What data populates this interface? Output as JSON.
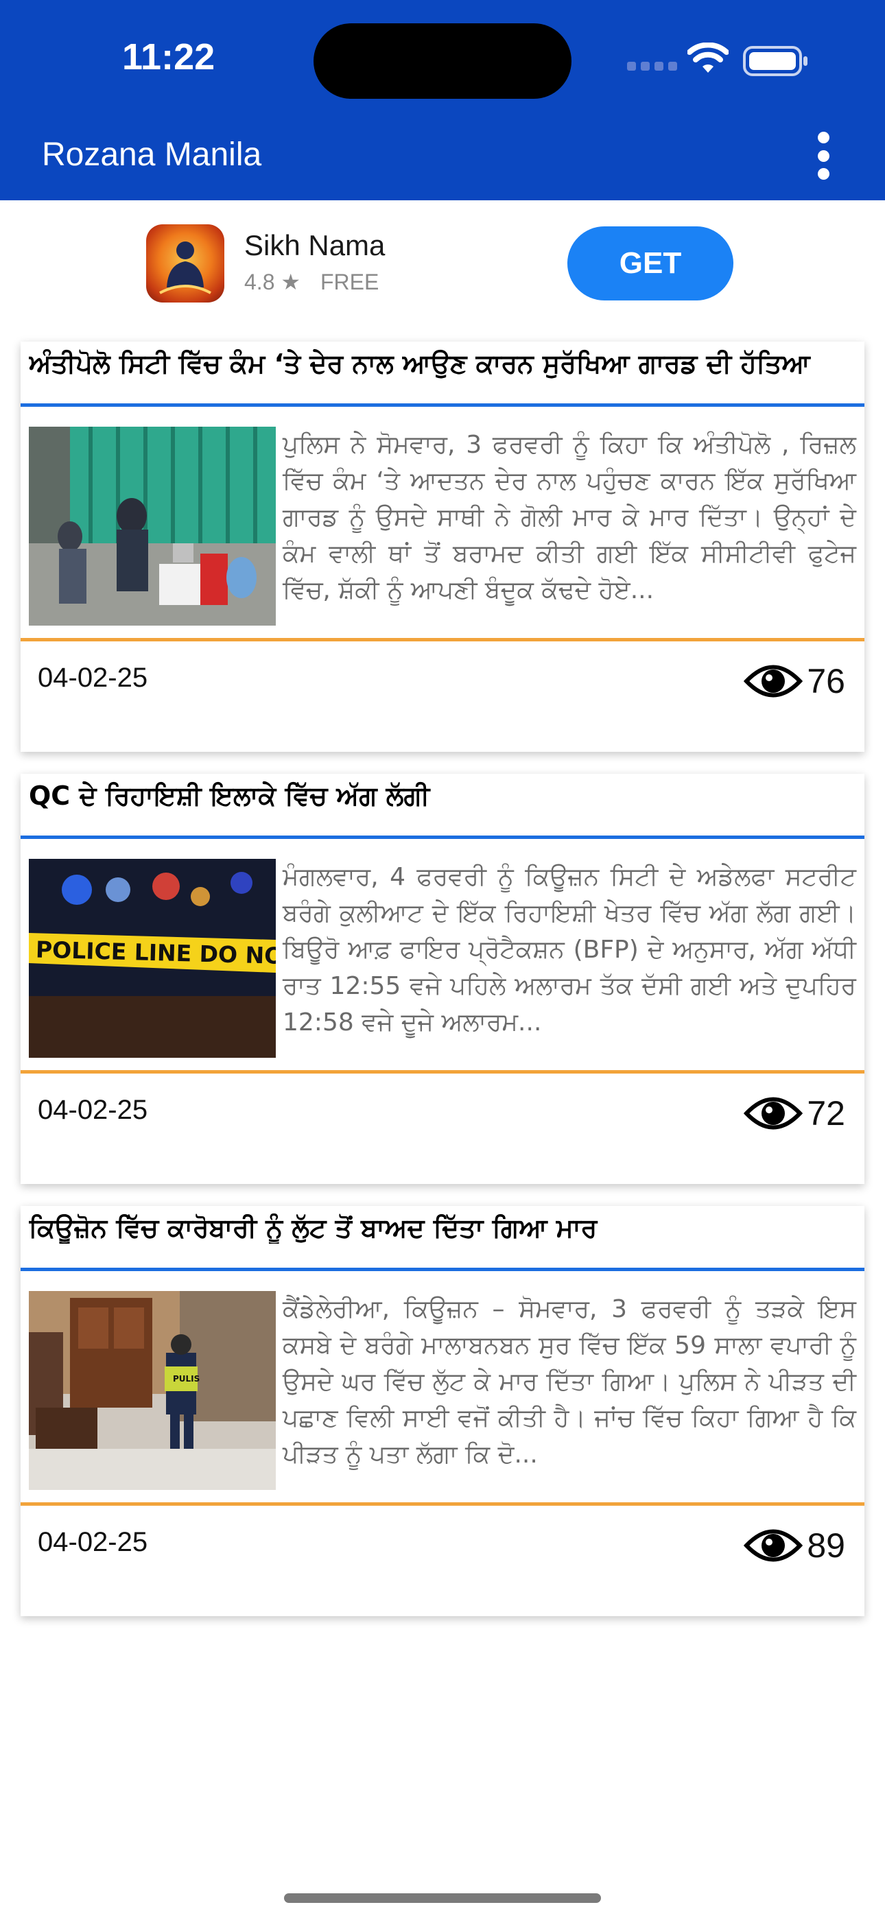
{
  "status_bar": {
    "time": "11:22"
  },
  "header": {
    "title": "Rozana Manila",
    "menu_icon": "more-vertical-icon"
  },
  "ad": {
    "app_name": "Sikh Nama",
    "rating": "4.8",
    "rating_icon": "star-icon",
    "price": "FREE",
    "cta": "GET"
  },
  "articles": [
    {
      "title": "ਅੰਤੀਪੋਲੋ ਸਿਟੀ ਵਿੱਚ ਕੰਮ ‘ਤੇ ਦੇਰ ਨਾਲ ਆਉਣ ਕਾਰਨ ਸੁਰੱਖਿਆ ਗਾਰਡ ਦੀ ਹੱਤਿਆ",
      "excerpt": "ਪੁਲਿਸ ਨੇ ਸੋਮਵਾਰ, 3 ਫਰਵਰੀ ਨੂੰ ਕਿਹਾ ਕਿ ਅੰਤੀਪੋਲੋ , ਰਿਜ਼ਲ ਵਿੱਚ ਕੰਮ ‘ਤੇ ਆਦਤਨ ਦੇਰ ਨਾਲ ਪਹੁੰਚਣ ਕਾਰਨ ਇੱਕ ਸੁਰੱਖਿਆ ਗਾਰਡ ਨੂੰ ਉਸਦੇ ਸਾਥੀ ਨੇ ਗੋਲੀ ਮਾਰ ਕੇ ਮਾਰ ਦਿੱਤਾ। ਉਨ੍ਹਾਂ ਦੇ ਕੰਮ ਵਾਲੀ ਥਾਂ ਤੋਂ ਬਰਾਮਦ ਕੀਤੀ ਗਈ ਇੱਕ ਸੀਸੀਟੀਵੀ ਫੁਟੇਜ ਵਿੱਚ, ਸ਼ੱਕੀ ਨੂੰ ਆਪਣੀ ਬੰਦੂਕ ਕੱਢਦੇ ਹੋਏ...",
      "date": "04-02-25",
      "views": "76"
    },
    {
      "title": "QC ਦੇ ਰਿਹਾਇਸ਼ੀ ਇਲਾਕੇ ਵਿੱਚ ਅੱਗ ਲੱਗੀ",
      "image_text": "POLICE LINE DO NOT CROSS",
      "excerpt": "ਮੰਗਲਵਾਰ, 4 ਫਰਵਰੀ ਨੂੰ ਕਿਊਜ਼ਨ ਸਿਟੀ ਦੇ ਅਡੇਲਫਾ ਸਟਰੀਟ ਬਰੰਗੇ ਕੁਲੀਆਟ ਦੇ ਇੱਕ ਰਿਹਾਇਸ਼ੀ ਖੇਤਰ ਵਿੱਚ ਅੱਗ ਲੱਗ ਗਈ। ਬਿਊਰੋ ਆਫ਼ ਫਾਇਰ ਪ੍ਰੋਟੈਕਸ਼ਨ (BFP) ਦੇ ਅਨੁਸਾਰ, ਅੱਗ ਅੱਧੀ ਰਾਤ 12:55 ਵਜੇ ਪਹਿਲੇ ਅਲਾਰਮ ਤੱਕ ਦੱਸੀ ਗਈ ਅਤੇ ਦੁਪਹਿਰ 12:58 ਵਜੇ ਦੂਜੇ ਅਲਾਰਮ...",
      "date": "04-02-25",
      "views": "72"
    },
    {
      "title": "ਕਿਊਜ਼ੋਨ ਵਿੱਚ ਕਾਰੋਬਾਰੀ ਨੂੰ ਲੁੱਟ ਤੋਂ ਬਾਅਦ ਦਿੱਤਾ ਗਿਆ ਮਾਰ",
      "image_text": "PULIS",
      "excerpt": "ਕੈਂਡੇਲੇਰੀਆ, ਕਿਊਜ਼ਨ – ਸੋਮਵਾਰ, 3 ਫਰਵਰੀ ਨੂੰ ਤੜਕੇ ਇਸ ਕਸਬੇ ਦੇ ਬਰੰਗੇ ਮਾਲਾਬਨਬਨ ਸੁਰ ਵਿੱਚ ਇੱਕ 59 ਸਾਲਾ ਵਪਾਰੀ ਨੂੰ ਉਸਦੇ ਘਰ ਵਿੱਚ ਲੁੱਟ ਕੇ ਮਾਰ ਦਿੱਤਾ ਗਿਆ। ਪੁਲਿਸ ਨੇ ਪੀੜਤ ਦੀ ਪਛਾਣ ਵਿਲੀ ਸਾਈ ਵਜੋਂ ਕੀਤੀ ਹੈ। ਜਾਂਚ ਵਿੱਚ ਕਿਹਾ ਗਿਆ ਹੈ ਕਿ ਪੀੜਤ ਨੂੰ ਪਤਾ ਲੱਗਾ ਕਿ ਦੋ...",
      "date": "04-02-25",
      "views": "89"
    }
  ],
  "colors": {
    "header_bg": "#0b47bf",
    "title_rule": "#1c6ee0",
    "footer_rule": "#f2a33a",
    "get_button": "#1b82f5"
  }
}
